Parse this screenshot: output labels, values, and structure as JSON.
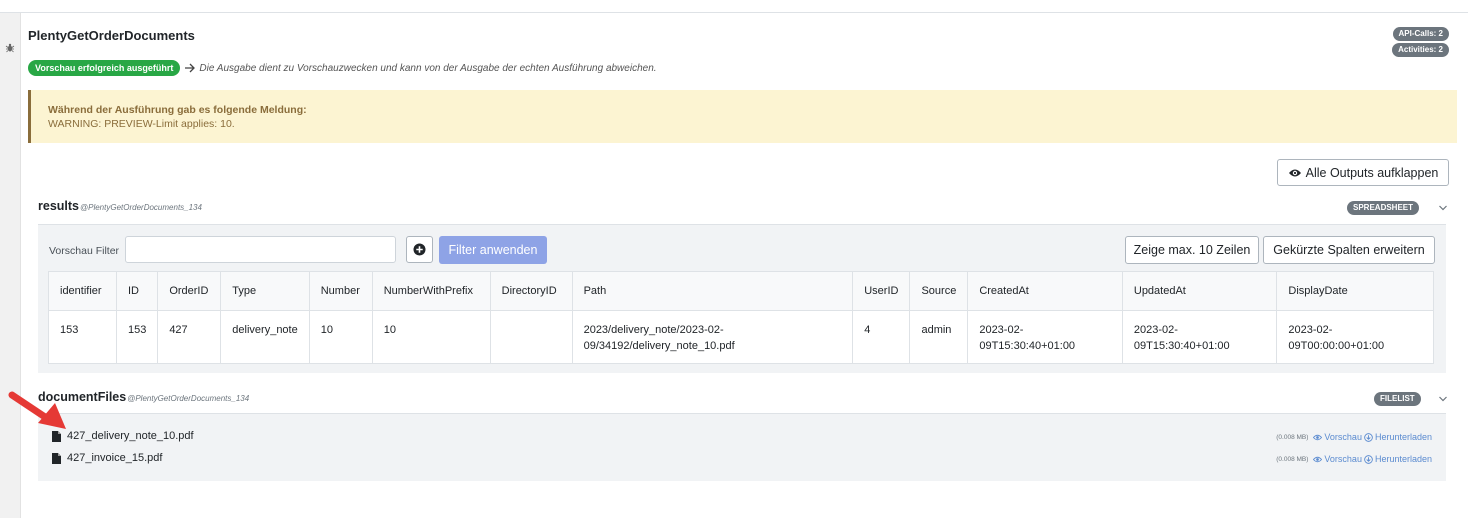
{
  "block": {
    "title": "PlentyGetOrderDocuments",
    "api_calls": "API-Calls: 2",
    "activities": "Activities: 2",
    "status_badge": "Vorschau erfolgreich ausgeführt",
    "status_note": "Die Ausgabe dient zu Vorschauzwecken und kann von der Ausgabe der echten Ausführung abweichen."
  },
  "alert": {
    "heading": "Während der Ausführung gab es folgende Meldung:",
    "message": "WARNING: PREVIEW-Limit applies: 10."
  },
  "toolbar": {
    "expand_all_label": "Alle Outputs aufklappen"
  },
  "results": {
    "name": "results",
    "source": "@PlentyGetOrderDocuments_134",
    "type": "SPREADSHEET",
    "filter": {
      "label": "Vorschau Filter",
      "value": "",
      "apply_label": "Filter anwenden",
      "max_rows_label": "Zeige max. 10 Zeilen",
      "expand_cols_label": "Gekürzte Spalten erweitern"
    },
    "columns": [
      "identifier",
      "ID",
      "OrderID",
      "Type",
      "Number",
      "NumberWithPrefix",
      "DirectoryID",
      "Path",
      "UserID",
      "Source",
      "CreatedAt",
      "UpdatedAt",
      "DisplayDate"
    ],
    "rows": [
      [
        "153",
        "153",
        "427",
        "delivery_note",
        "10",
        "10",
        "",
        "2023/delivery_note/2023-02-09/34192/delivery_note_10.pdf",
        "4",
        "admin",
        "2023-02-09T15:30:40+01:00",
        "2023-02-09T15:30:40+01:00",
        "2023-02-09T00:00:00+01:00"
      ]
    ]
  },
  "files": {
    "name": "documentFiles",
    "source": "@PlentyGetOrderDocuments_134",
    "type": "FILELIST",
    "preview_label": "Vorschau",
    "download_label": "Herunterladen",
    "items": [
      {
        "name": "427_delivery_note_10.pdf",
        "size": "(0.008 MB)"
      },
      {
        "name": "427_invoice_15.pdf",
        "size": "(0.008 MB)"
      }
    ]
  }
}
